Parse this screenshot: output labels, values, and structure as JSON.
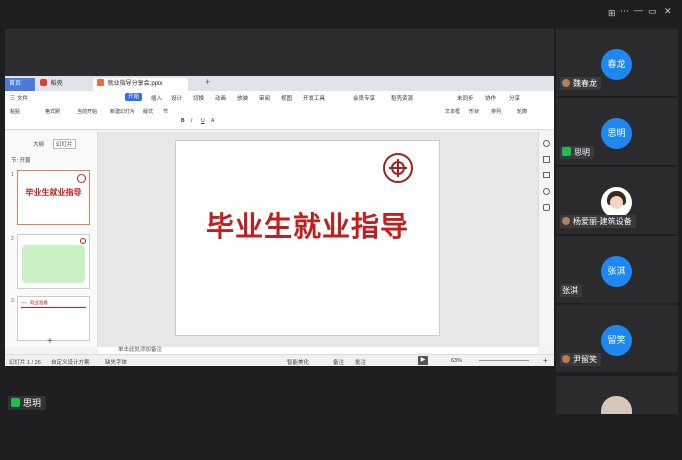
{
  "wps": {
    "tabs": {
      "home": "首页",
      "wps": "稻壳",
      "doc": "就业指导分享会.pptx"
    },
    "menu": [
      "三 文件",
      "开始",
      "插入",
      "设计",
      "切换",
      "动画",
      "放映",
      "审阅",
      "视图",
      "开发工具",
      "会员专享",
      "稻壳资源"
    ],
    "menu_right": [
      "未同步",
      "协作",
      "分享"
    ],
    "ribbon": [
      "粘贴",
      "格式刷",
      "当前开始",
      "新建幻灯片",
      "版式",
      "节",
      "文本框",
      "形状",
      "排列",
      "轮廓"
    ],
    "leftpanel": {
      "tab_outline": "大纲",
      "tab_slides": "幻灯片",
      "section": "节: 开篇"
    },
    "thumbs": [
      {
        "num": "1",
        "title": "毕业生就业指导"
      },
      {
        "num": "2",
        "title": ""
      },
      {
        "num": "3",
        "title": "一、就业准备"
      }
    ],
    "slide": {
      "title": "毕业生就业指导"
    },
    "notes": "单击此处添加备注",
    "status": {
      "slide_count": "幻灯片 1 / 26",
      "design": "自定义设计方案",
      "fonts": "缺失字体",
      "beautify": "智能美化",
      "notes_btn": "备注",
      "comments": "批注",
      "zoom": "63%"
    }
  },
  "participants": [
    {
      "avatar": "春龙",
      "name": "魏春龙",
      "color": "#1e87f0"
    },
    {
      "avatar": "思明",
      "name": "思明",
      "color": "#1e87f0"
    },
    {
      "avatar": "",
      "name": "杨爱丽-建筑设备",
      "color": "#ffffff"
    },
    {
      "avatar": "张淇",
      "name": "张淇",
      "color": "#1e87f0"
    },
    {
      "avatar": "留笑",
      "name": "尹留笑",
      "color": "#1e87f0"
    }
  ],
  "bottom": {
    "name": "思玥"
  },
  "controls": {
    "grid": "⊞",
    "minimize": "—",
    "maximize": "▭",
    "close": "✕",
    "more": "⋯"
  }
}
